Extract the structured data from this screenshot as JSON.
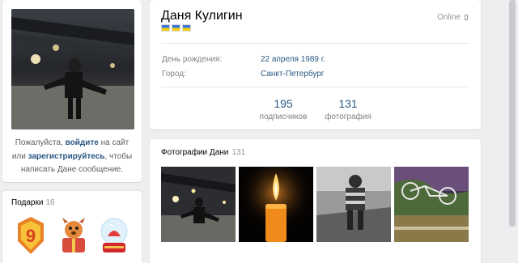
{
  "profile": {
    "name": "Даня Кулигин",
    "status": "Online",
    "birthday_label": "День рождения:",
    "birthday_value": "22 апреля 1989 г.",
    "city_label": "Город:",
    "city_value": "Санкт-Петербург",
    "counters": [
      {
        "value": "195",
        "label": "подписчиков"
      },
      {
        "value": "131",
        "label": "фотография"
      }
    ]
  },
  "login_hint": {
    "prefix": "Пожалуйста, ",
    "login_link": "войдите",
    "middle": " на сайт или ",
    "register_link": "зарегистрируйтесь",
    "suffix": ", чтобы написать Дане сообщение."
  },
  "gifts": {
    "title": "Подарки",
    "count": "16"
  },
  "photos": {
    "title": "Фотографии Дани",
    "count": "131"
  },
  "colors": {
    "link": "#2a5885",
    "background": "#edeef0"
  }
}
